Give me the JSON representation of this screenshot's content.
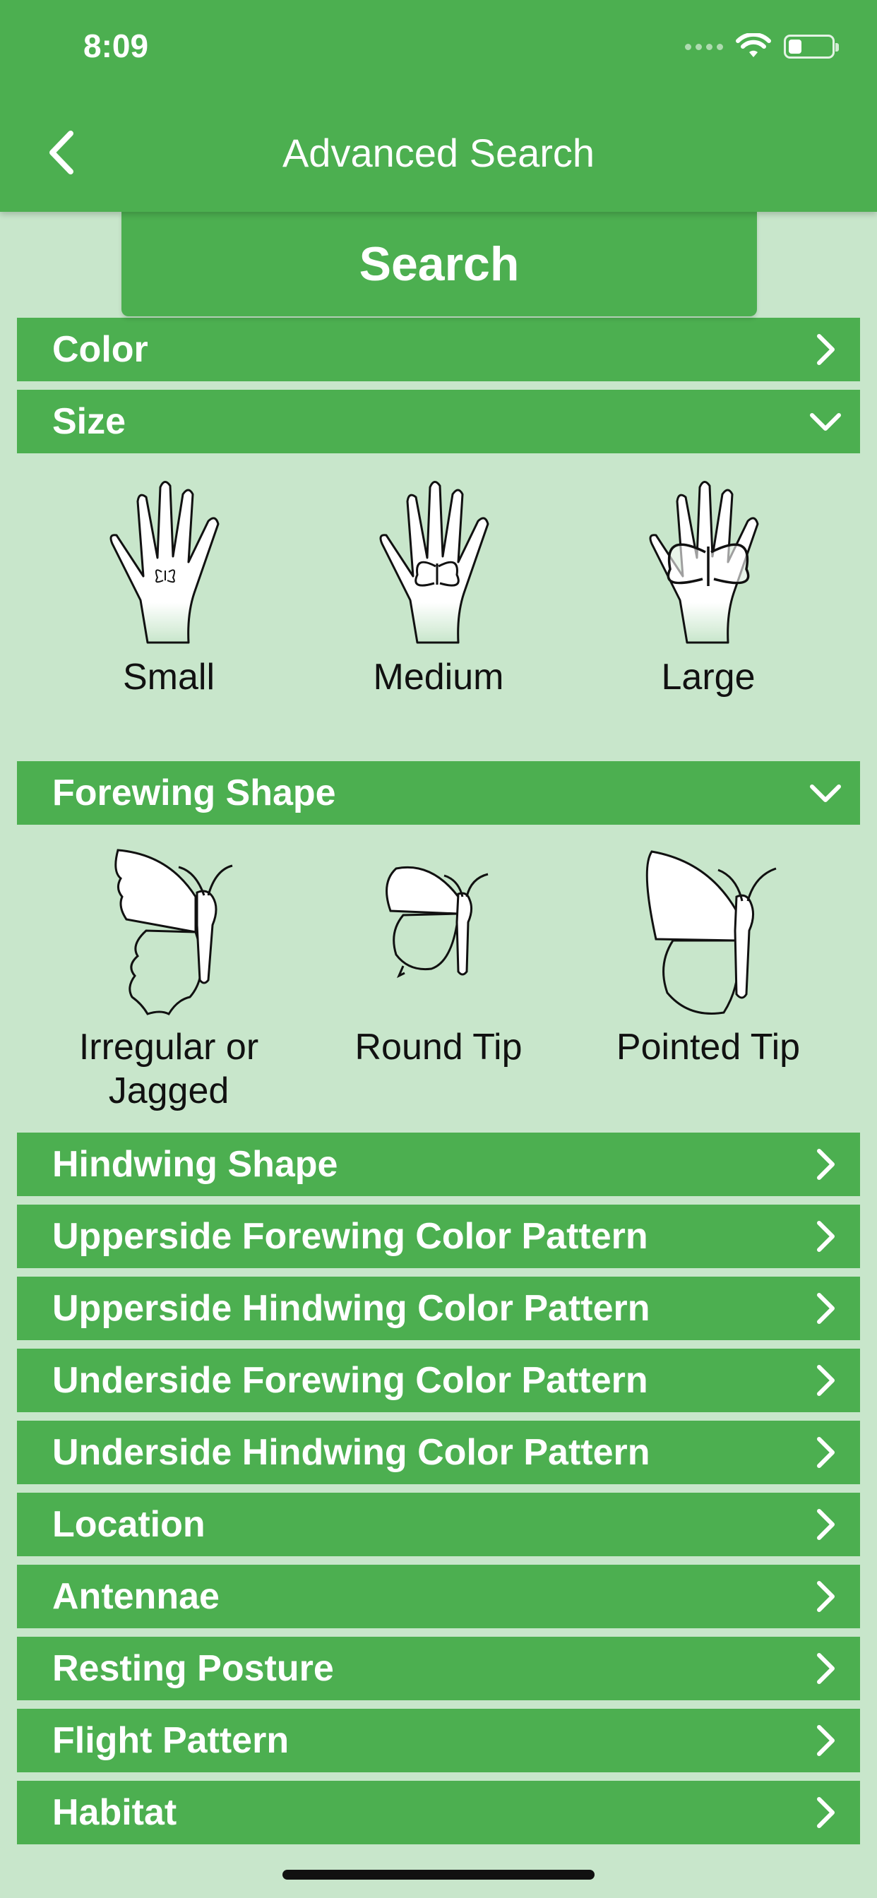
{
  "status_bar": {
    "time": "8:09"
  },
  "nav": {
    "title": "Advanced Search"
  },
  "search_tab": {
    "label": "Search"
  },
  "sections": {
    "color": "Color",
    "size": "Size",
    "forewing": "Forewing Shape",
    "hindwing": "Hindwing Shape",
    "upperside_forewing": "Upperside Forewing Color Pattern",
    "upperside_hindwing": "Upperside Hindwing Color Pattern",
    "underside_forewing": "Underside Forewing Color Pattern",
    "underside_hindwing": "Underside Hindwing Color Pattern",
    "location": "Location",
    "antennae": "Antennae",
    "resting_posture": "Resting Posture",
    "flight_pattern": "Flight Pattern",
    "habitat": "Habitat"
  },
  "size_options": [
    "Small",
    "Medium",
    "Large"
  ],
  "forewing_options": [
    "Irregular or Jagged",
    "Round Tip",
    "Pointed Tip"
  ],
  "colors": {
    "primary": "#4caf50",
    "background": "#c8e6cb",
    "text_on_primary": "#ffffff"
  }
}
